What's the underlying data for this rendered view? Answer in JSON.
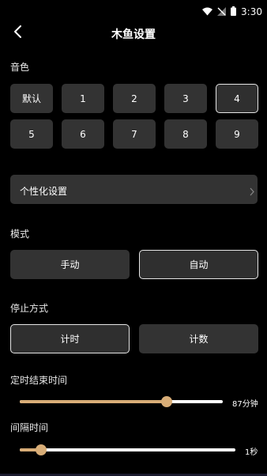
{
  "status_bar": {
    "time": "3:30",
    "icons": [
      "wifi-icon",
      "no-signal-icon",
      "battery-icon"
    ]
  },
  "header": {
    "title": "木鱼设置",
    "back_icon": "back-chevron-icon"
  },
  "sound": {
    "label": "音色",
    "options": [
      "默认",
      "1",
      "2",
      "3",
      "4",
      "5",
      "6",
      "7",
      "8",
      "9"
    ],
    "selected": "4"
  },
  "personalize": {
    "label": "个性化设置",
    "chevron_icon": "chevron-right-icon"
  },
  "mode": {
    "label": "模式",
    "options": [
      "手动",
      "自动"
    ],
    "selected": "自动"
  },
  "stop": {
    "label": "停止方式",
    "options": [
      "计时",
      "计数"
    ],
    "selected": "计时"
  },
  "timer": {
    "label": "定时结束时间",
    "value": 87,
    "max": 120,
    "value_text": "87分钟"
  },
  "interval": {
    "label": "间隔时间",
    "value": 1,
    "max": 10,
    "value_text": "1秒"
  },
  "colors": {
    "accent": "#d8ad77",
    "button_bg": "#333333",
    "background": "#000000"
  }
}
